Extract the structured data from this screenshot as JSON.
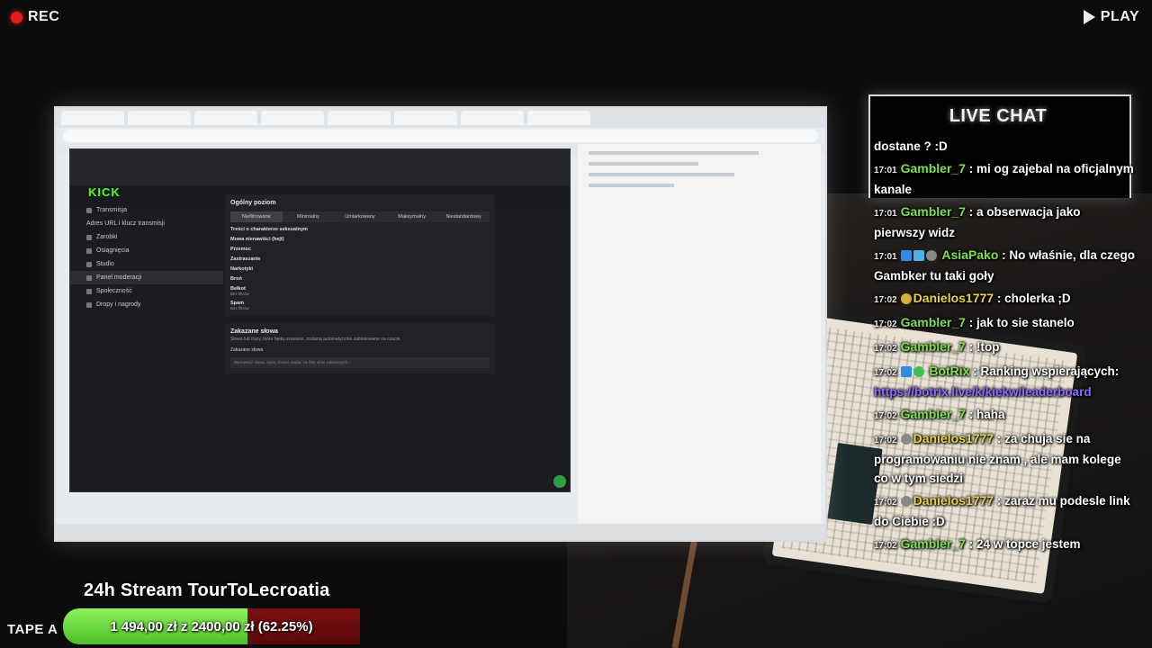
{
  "overlay": {
    "rec_label": "REC",
    "play_label": "PLAY",
    "tape_label": "TAPE A",
    "stream_title": "24h Stream TourToLecroatia",
    "goal": {
      "text": "1 494,00 zł z 2400,00 zł (62.25%)",
      "progress_fraction": 0.6225,
      "fill_color": "#6fdc3f",
      "track_color": "#6e0c10"
    }
  },
  "kick": {
    "logo": "KICK",
    "sidebar": [
      {
        "label": "Transmisja",
        "icon": "broadcast-icon"
      },
      {
        "label": "Adres URL i klucz transmisji",
        "icon": ""
      },
      {
        "label": "Zarobki",
        "icon": "money-icon"
      },
      {
        "label": "Osiągnięcia",
        "icon": "trophy-icon"
      },
      {
        "label": "Studio",
        "icon": "studio-icon"
      },
      {
        "label": "Panel moderacji",
        "icon": "hammer-icon"
      },
      {
        "label": "Społeczność",
        "icon": "users-icon"
      },
      {
        "label": "Dropy i nagrody",
        "icon": "gift-icon"
      }
    ],
    "general_label": "Ogólny poziom",
    "levels": [
      "Nieflitrowane",
      "Minimalny",
      "Umiarkowany",
      "Maksymalny",
      "Niestandardowy"
    ],
    "categories": [
      {
        "name": "Treści o charakterze seksualnym"
      },
      {
        "name": "Mowa nienawiści (hejt)"
      },
      {
        "name": "Przemoc"
      },
      {
        "name": "Zastraszanie"
      },
      {
        "name": "Narkotyki"
      },
      {
        "name": "Broń"
      },
      {
        "name": "Bełkot",
        "desc": "Bez filtrów"
      },
      {
        "name": "Spam",
        "desc": "Bez filtrów"
      }
    ],
    "banned_words_title": "Zakazane słowa",
    "banned_words_sub": "Słowa lub frazy, które będą usuwane, zostaną automatycznie zablokowane na czacie.",
    "banned_words_field_label": "Zakazane słowa",
    "banned_words_placeholder": "Wprowadź słowo, którą chcesz dodać na listę słów zakazanych..."
  },
  "chat": {
    "title": "LIVE CHAT",
    "messages": [
      {
        "time": "",
        "user": "",
        "text": "dostane ? :D"
      },
      {
        "time": "17:01",
        "user": "Gambler_7",
        "text": ": mi og zajebal na oficjalnym kanale",
        "user_color": "#7ee04a"
      },
      {
        "time": "17:01",
        "user": "Gambler_7",
        "text": ": a obserwacja jako pierwszy widz",
        "user_color": "#7ee04a"
      },
      {
        "time": "17:01",
        "user": "AsiaPako",
        "text": ": No właśnie, dla czego Gambker tu taki goły",
        "user_color": "#7ee04a"
      },
      {
        "time": "17:02",
        "user": "Danielos1777",
        "text": ": cholerka ;D",
        "user_color": "#e8d24a"
      },
      {
        "time": "17:02",
        "user": "Gambler_7",
        "text": ": jak to sie stanelo",
        "user_color": "#7ee04a"
      },
      {
        "time": "17:02",
        "user": "Gambler_7",
        "text": ": !top",
        "user_color": "#7ee04a"
      },
      {
        "time": "17:02",
        "user": "BotRix",
        "text": ": Ranking wspierających:",
        "link": "https://botrix.live/k/kiekw/leaderboard",
        "user_color": "#7ee04a"
      },
      {
        "time": "17:02",
        "user": "Gambler_7",
        "text": ": haha",
        "user_color": "#7ee04a"
      },
      {
        "time": "17:02",
        "user": "Danielos1777",
        "text": ": za chuja sie na programowaniu nie znam , ale mam kolege co w tym siedzi",
        "user_color": "#e8d24a"
      },
      {
        "time": "17:02",
        "user": "Danielos1777",
        "text": ": zaraz mu podesle link do Ciebie :D",
        "user_color": "#e8d24a"
      },
      {
        "time": "17:02",
        "user": "Gambler_7",
        "text": ": 24 w topce jestem",
        "user_color": "#7ee04a"
      }
    ]
  }
}
